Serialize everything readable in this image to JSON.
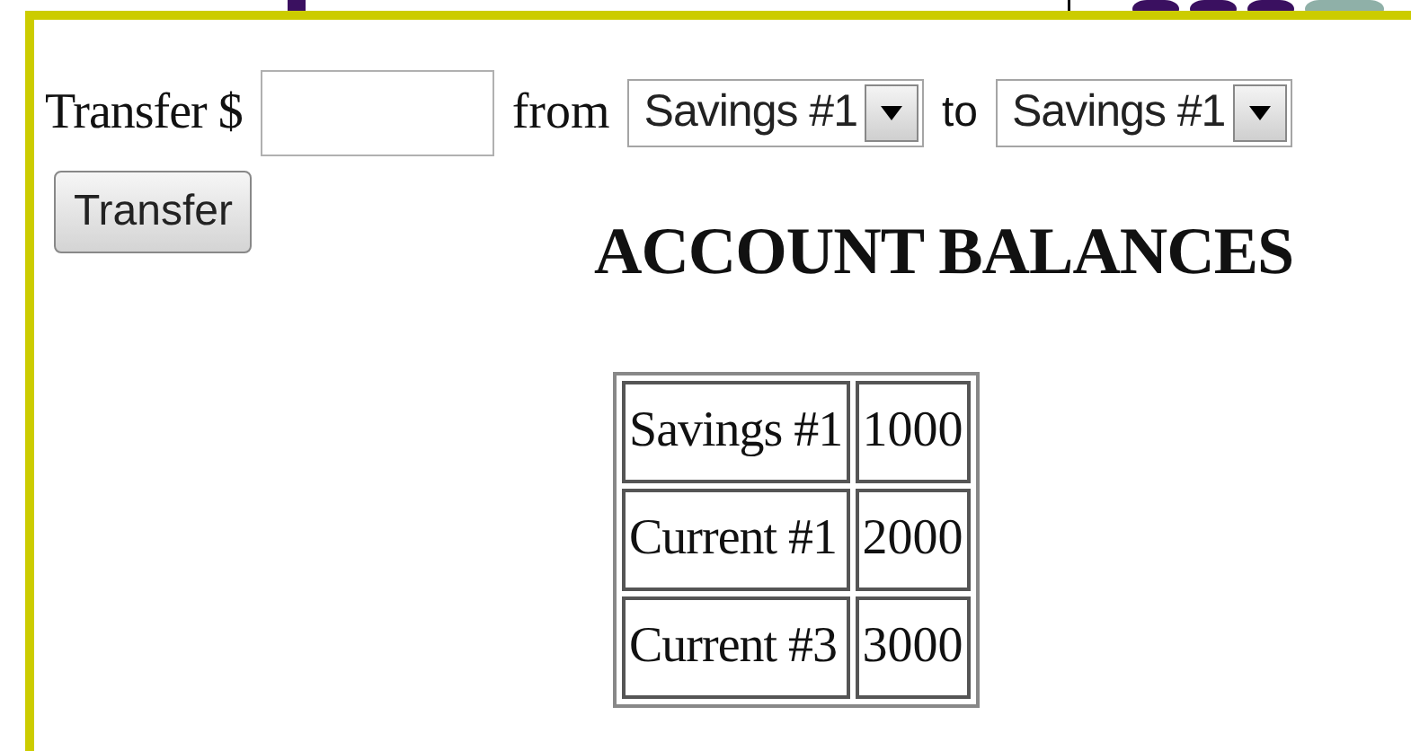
{
  "transfer_form": {
    "label": "Transfer $",
    "from_label": "from",
    "from_select": {
      "value": "Savings #1"
    },
    "to_label": "to",
    "to_select": {
      "value": "Savings #1"
    },
    "button": "Transfer"
  },
  "heading": "ACCOUNT BALANCES",
  "balances_table": {
    "rows": [
      {
        "account": "Savings #1",
        "balance": "1000"
      },
      {
        "account": "Current #1",
        "balance": "2000"
      },
      {
        "account": "Current #3",
        "balance": "3000"
      }
    ]
  }
}
